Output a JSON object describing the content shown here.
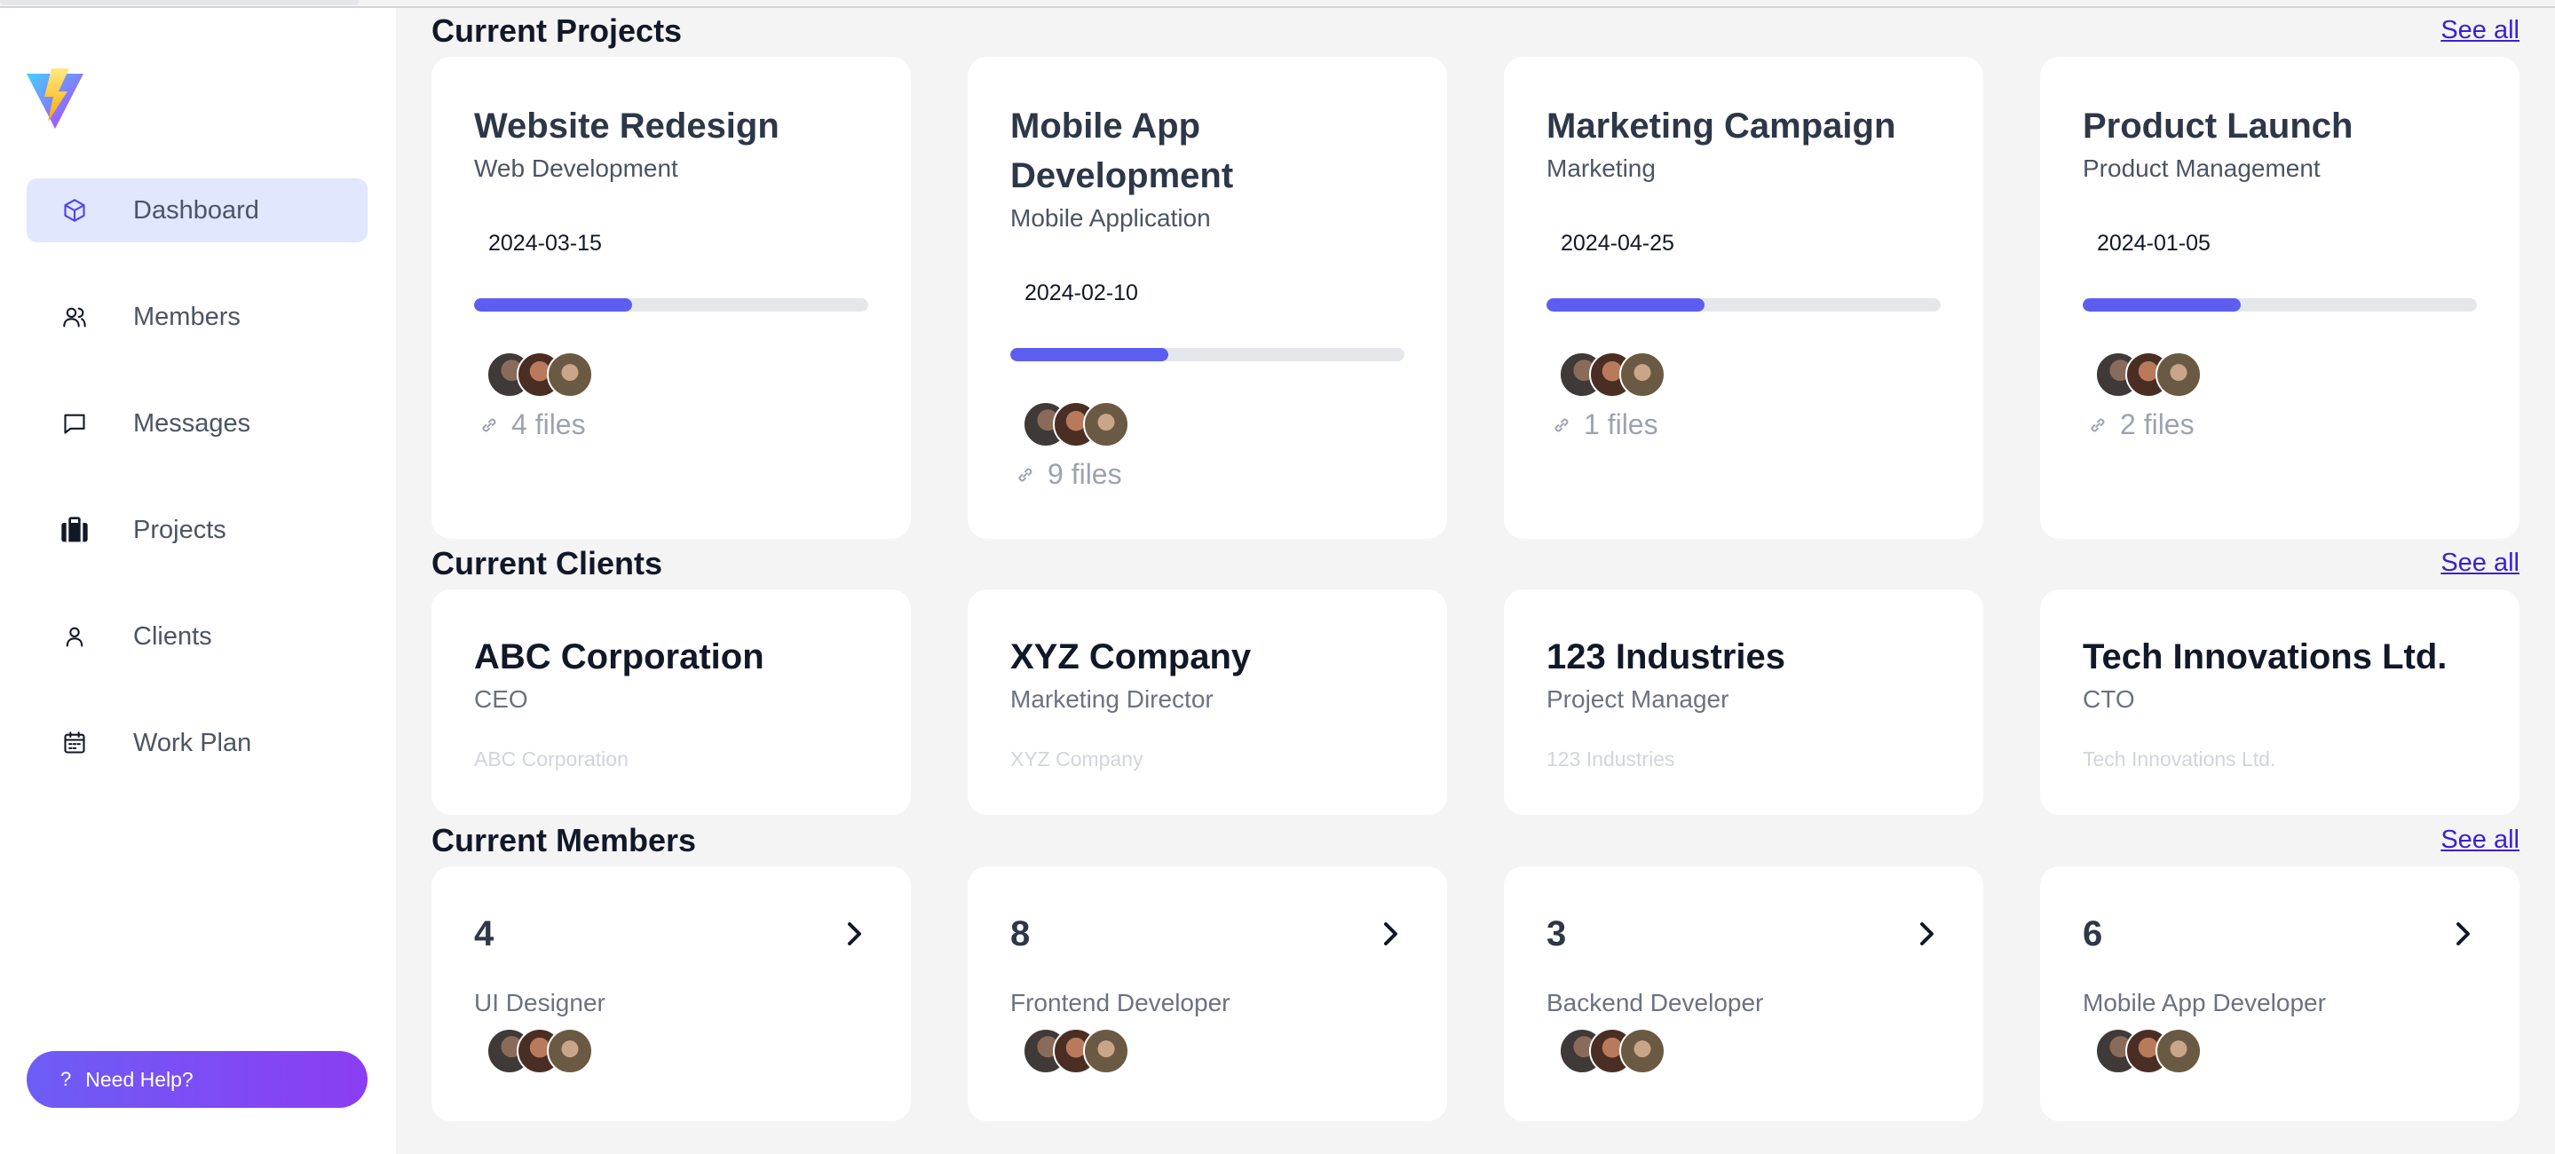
{
  "sidebar": {
    "items": [
      {
        "label": "Dashboard",
        "icon": "cube-icon",
        "active": true
      },
      {
        "label": "Members",
        "icon": "users-icon"
      },
      {
        "label": "Messages",
        "icon": "chat-icon"
      },
      {
        "label": "Projects",
        "icon": "briefcase-icon"
      },
      {
        "label": "Clients",
        "icon": "user-icon"
      },
      {
        "label": "Work Plan",
        "icon": "calendar-icon"
      }
    ],
    "help": {
      "icon": "?",
      "label": "Need Help?"
    }
  },
  "sections": {
    "projects": {
      "title": "Current Projects",
      "see_all": "See all"
    },
    "clients": {
      "title": "Current Clients",
      "see_all": "See all"
    },
    "members": {
      "title": "Current Members",
      "see_all": "See all"
    }
  },
  "projects": [
    {
      "title": "Website Redesign",
      "category": "Web Development",
      "date": "2024-03-15",
      "progress": 0.4,
      "files": "4 files"
    },
    {
      "title": "Mobile App Development",
      "category": "Mobile Application",
      "date": "2024-02-10",
      "progress": 0.4,
      "files": "9 files"
    },
    {
      "title": "Marketing Campaign",
      "category": "Marketing",
      "date": "2024-04-25",
      "progress": 0.4,
      "files": "1 files"
    },
    {
      "title": "Product Launch",
      "category": "Product Management",
      "date": "2024-01-05",
      "progress": 0.4,
      "files": "2 files"
    }
  ],
  "clients": [
    {
      "name": "ABC Corporation",
      "role": "CEO",
      "company": "ABC Corporation"
    },
    {
      "name": "XYZ Company",
      "role": "Marketing Director",
      "company": "XYZ Company"
    },
    {
      "name": "123 Industries",
      "role": "Project Manager",
      "company": "123 Industries"
    },
    {
      "name": "Tech Innovations Ltd.",
      "role": "CTO",
      "company": "Tech Innovations Ltd."
    }
  ],
  "members": [
    {
      "count": "4",
      "role": "UI Designer"
    },
    {
      "count": "8",
      "role": "Frontend Developer"
    },
    {
      "count": "3",
      "role": "Backend Developer"
    },
    {
      "count": "6",
      "role": "Mobile App Developer"
    }
  ],
  "colors": {
    "accent": "#5b5ef0",
    "active_nav": "#e0e7ff",
    "link": "#3b1fd1"
  }
}
